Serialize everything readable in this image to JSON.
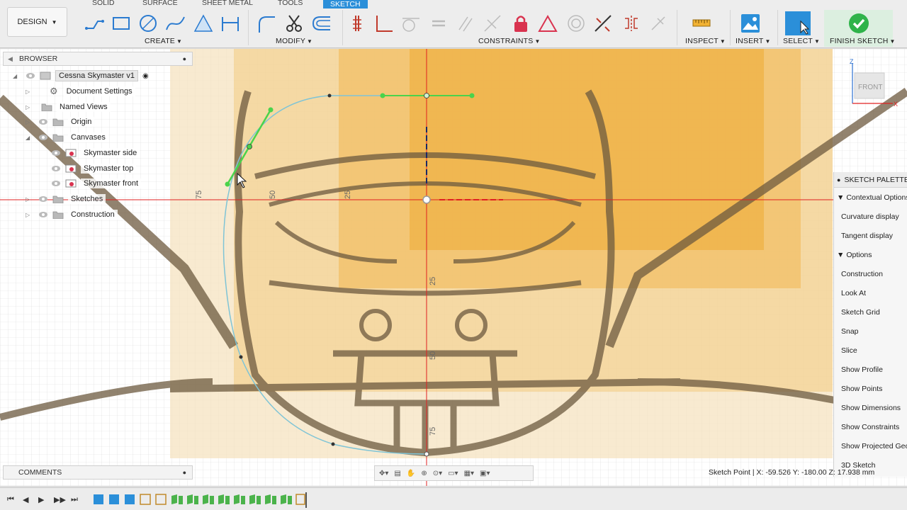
{
  "tabs": {
    "solid": "SOLID",
    "surface": "SURFACE",
    "sheet_metal": "SHEET METAL",
    "tools": "TOOLS",
    "sketch": "SKETCH"
  },
  "design_button": "DESIGN",
  "toolbar_groups": {
    "create": "CREATE",
    "modify": "MODIFY",
    "constraints": "CONSTRAINTS",
    "inspect": "INSPECT",
    "insert": "INSERT",
    "select": "SELECT",
    "finish_sketch": "FINISH SKETCH"
  },
  "browser": {
    "title": "BROWSER",
    "root": "Cessna Skymaster v1",
    "items": [
      {
        "label": "Document Settings",
        "icon": "gear-icon"
      },
      {
        "label": "Named Views",
        "icon": "folder-icon"
      },
      {
        "label": "Origin",
        "icon": "folder-icon"
      },
      {
        "label": "Canvases",
        "icon": "folder-icon"
      },
      {
        "label": "Skymaster side",
        "icon": "canvas-image-icon"
      },
      {
        "label": "Skymaster top",
        "icon": "canvas-image-icon"
      },
      {
        "label": "Skymaster front",
        "icon": "canvas-image-icon"
      },
      {
        "label": "Sketches",
        "icon": "folder-icon"
      },
      {
        "label": "Construction",
        "icon": "folder-icon"
      }
    ]
  },
  "viewcube": {
    "face": "FRONT",
    "axis_z": "Z",
    "axis_x": "X"
  },
  "canvas_labels": {
    "l75": "75",
    "l50": "50",
    "l25": "25",
    "v25": "25",
    "v50": "50",
    "v75": "75"
  },
  "palette": {
    "title": "SKETCH PALETTE",
    "contextual": "Contextual Options",
    "contextual_items": [
      "Curvature display",
      "Tangent display"
    ],
    "options": "Options",
    "option_items": [
      "Construction",
      "Look At",
      "Sketch Grid",
      "Snap",
      "Slice",
      "Show Profile",
      "Show Points",
      "Show Dimensions",
      "Show Constraints",
      "Show Projected Geometries",
      "3D Sketch"
    ]
  },
  "comments": "COMMENTS",
  "status": "Sketch Point | X: -59.526 Y: -180.00 Z: 17.938 mm",
  "colors": {
    "accent": "#2b8fd9",
    "finish_green": "#2fb34a",
    "sketch_line": "#7fc4d6",
    "select_green": "#4bd34b",
    "origin_red": "#e02020"
  }
}
